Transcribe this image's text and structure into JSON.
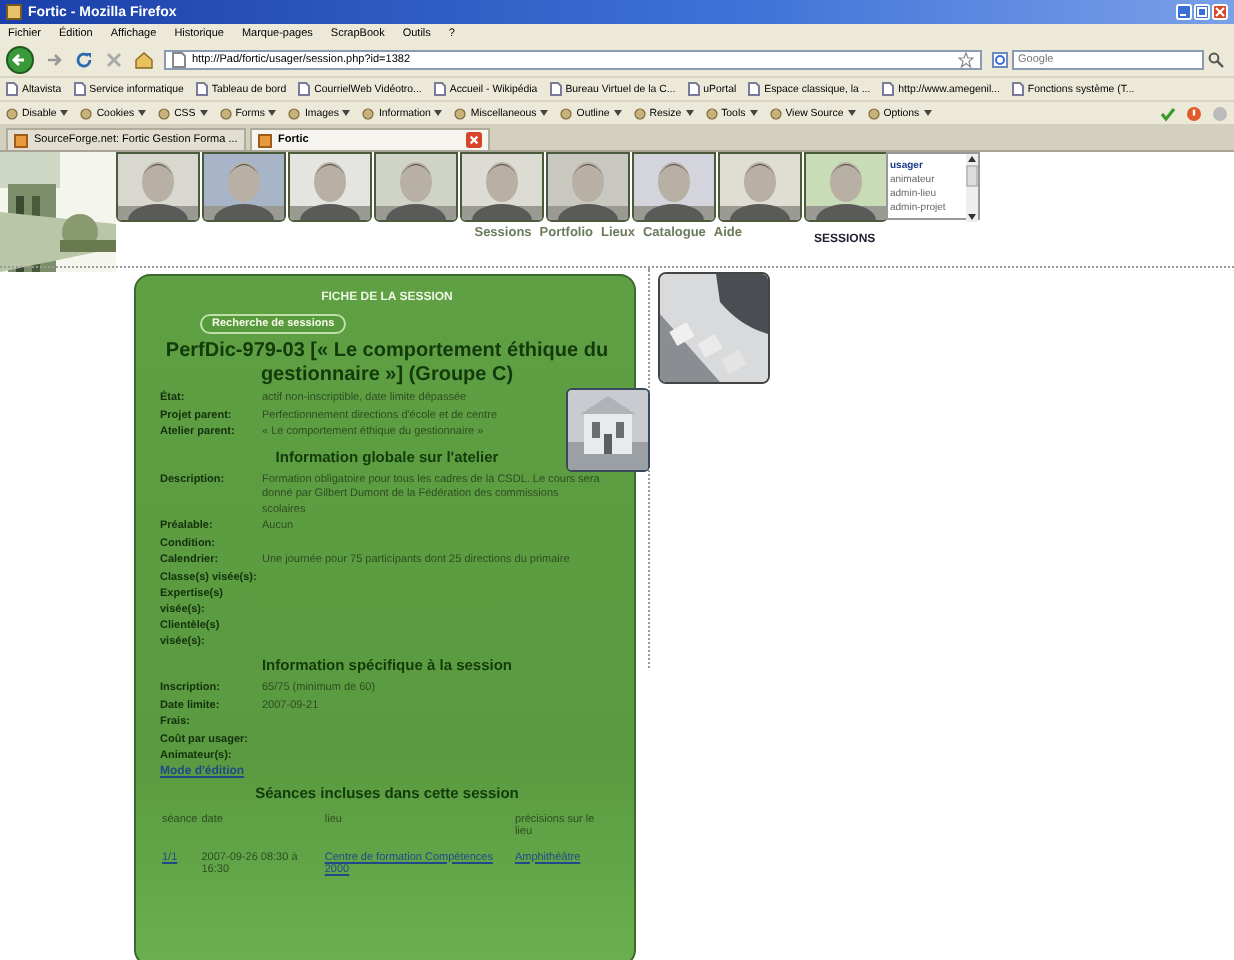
{
  "window": {
    "title": "Fortic - Mozilla Firefox"
  },
  "menu": [
    "Fichier",
    "Édition",
    "Affichage",
    "Historique",
    "Marque-pages",
    "ScrapBook",
    "Outils",
    "?"
  ],
  "address": {
    "value": "http://Pad/fortic/usager/session.php?id=1382"
  },
  "search": {
    "placeholder": "Google"
  },
  "bookmarks": [
    "Altavista",
    "Service informatique",
    "Tableau de bord",
    "CourrielWeb Vidéotro...",
    "Accueil - Wikipédia",
    "Bureau Virtuel de la C...",
    "uPortal",
    "Espace classique, la ...",
    "http://www.amegenil...",
    "Fonctions système (T..."
  ],
  "developer_toolbar": [
    "Disable",
    "Cookies",
    "CSS",
    "Forms",
    "Images",
    "Information",
    "Miscellaneous",
    "Outline",
    "Resize",
    "Tools",
    "View Source",
    "Options"
  ],
  "tabs": [
    {
      "label": "SourceForge.net: Fortic Gestion Forma ...",
      "selected": false
    },
    {
      "label": "Fortic",
      "selected": true
    }
  ],
  "header_photos": [
    {
      "kind": "picture"
    },
    {
      "kind": "picture"
    },
    {
      "kind": "picture"
    },
    {
      "kind": "picture"
    },
    {
      "kind": "picture"
    },
    {
      "kind": "picture"
    },
    {
      "kind": "picture"
    },
    {
      "kind": "picture"
    },
    {
      "kind": "picture"
    }
  ],
  "nav_links": [
    "Sessions",
    "Portfolio",
    "Lieux",
    "Catalogue",
    "Aide"
  ],
  "roles": [
    {
      "label": "usager",
      "selected": true
    },
    {
      "label": "animateur",
      "selected": false
    },
    {
      "label": "admin-lieu",
      "selected": false
    },
    {
      "label": "admin-projet",
      "selected": false
    }
  ],
  "section_label": "SESSIONS",
  "card": {
    "heading": "FICHE DE LA SESSION",
    "search_button": "Recherche de sessions",
    "title": "PerfDic-979-03 [« Le comportement éthique du gestionnaire »] (Groupe C)",
    "sections": [
      {
        "kind": "fields",
        "fields": [
          {
            "label": "État:",
            "value": "actif non-inscriptible, date limite dépassée"
          },
          {
            "label": "Projet parent:",
            "value": "Perfectionnement directions d'école et de centre"
          },
          {
            "label": "Atelier parent:",
            "value": "« Le comportement éthique du gestionnaire »"
          }
        ]
      },
      {
        "kind": "heading",
        "text": "Information globale sur l'atelier"
      },
      {
        "kind": "fields",
        "fields": [
          {
            "label": "Description:",
            "value": "Formation obligatoire pour tous les cadres de la CSDL. Le cours sera donné par Gilbert Dumont de la Fédération des commissions scolaires"
          },
          {
            "label": "Préalable:",
            "value": "Aucun"
          },
          {
            "label": "Condition:"
          },
          {
            "label": "Calendrier:",
            "value": "Une journée pour 75 participants dont 25 directions du primaire"
          },
          {
            "label": "Classe(s) visée(s):"
          },
          {
            "label": "Expertise(s) visée(s):"
          },
          {
            "label": "Clientèle(s) visée(s):"
          }
        ]
      },
      {
        "kind": "heading",
        "text": "Information spécifique à la session"
      },
      {
        "kind": "fields",
        "fields": [
          {
            "label": "Inscription:",
            "value": "65/75 (minimum de 60)"
          },
          {
            "label": "Date limite:",
            "value": "2007-09-21"
          },
          {
            "label": "Frais:"
          },
          {
            "label": "Coût par usager:"
          },
          {
            "label": "Animateur(s):"
          }
        ]
      },
      {
        "kind": "link",
        "text": "Mode d'édition"
      },
      {
        "kind": "heading",
        "text": "Séances incluses dans cette session"
      },
      {
        "kind": "table",
        "columns": [
          "séance",
          "date",
          "lieu",
          "précisions sur le lieu"
        ],
        "rows": [
          [
            "1/1",
            "2007-09-26 08:30 à 16:30",
            "Centre de formation Compétences 2000",
            "Amphithéâtre"
          ]
        ]
      }
    ]
  }
}
